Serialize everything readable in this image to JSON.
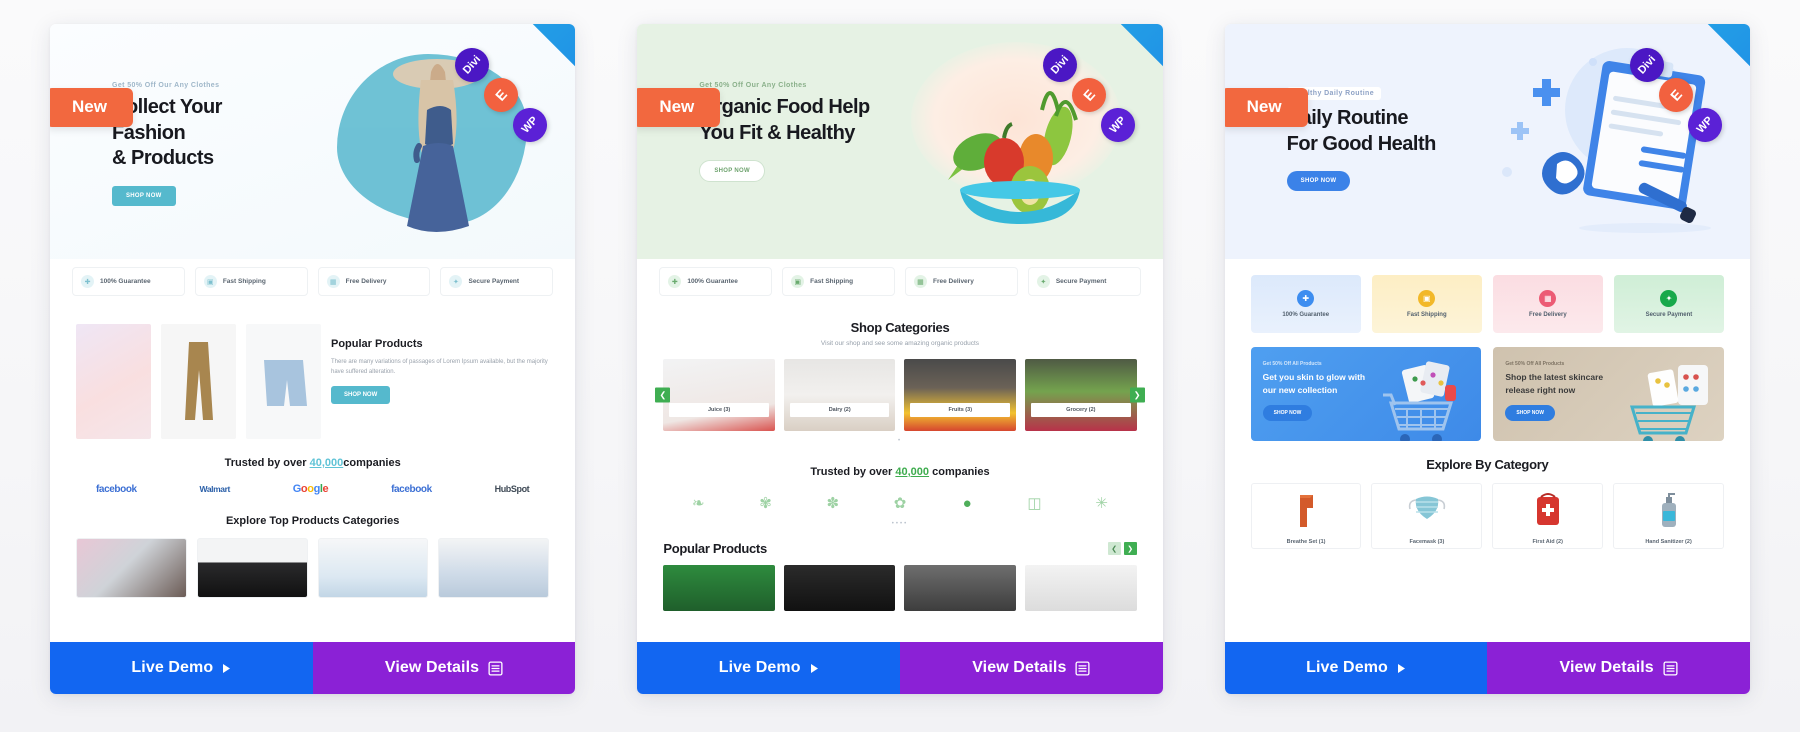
{
  "cards": [
    {
      "badge": "New",
      "ribbon": {
        "b1": "Divi",
        "b2": "E",
        "b3": "WP"
      },
      "hero": {
        "eyebrow": "Get 50% Off Our Any Clothes",
        "title": "Collect Your\nFashion\n& Products",
        "cta": "SHOP NOW"
      },
      "features": [
        {
          "label": "100% Guarantee",
          "icon": "shield-icon"
        },
        {
          "label": "Fast Shipping",
          "icon": "truck-icon"
        },
        {
          "label": "Free Delivery",
          "icon": "box-icon"
        },
        {
          "label": "Secure Payment",
          "icon": "lock-icon"
        }
      ],
      "popular": {
        "heading": "Popular Products",
        "body": "There are many variations of passages of Lorem Ipsum available, but the majority have suffered alteration.",
        "cta": "SHOP NOW"
      },
      "trusted": {
        "pre": "Trusted by over ",
        "num": "40,000",
        "post": "companies"
      },
      "logos": [
        "facebook",
        "Walmart",
        "Google",
        "facebook",
        "HubSpot"
      ],
      "explore": {
        "heading": "Explore Top Products Categories"
      },
      "actions": {
        "demo": "Live Demo",
        "details": "View Details"
      }
    },
    {
      "badge": "New",
      "ribbon": {
        "b1": "Divi",
        "b2": "E",
        "b3": "WP"
      },
      "hero": {
        "eyebrow": "Get 50% Off Our Any Clothes",
        "title": "Organic Food Help\nYou Fit & Healthy",
        "cta": "SHOP NOW"
      },
      "features": [
        {
          "label": "100% Guarantee",
          "icon": "shield-icon"
        },
        {
          "label": "Fast Shipping",
          "icon": "truck-icon"
        },
        {
          "label": "Free Delivery",
          "icon": "box-icon"
        },
        {
          "label": "Secure Payment",
          "icon": "lock-icon"
        }
      ],
      "shop": {
        "heading": "Shop Categories",
        "sub": "Visit our shop and see some amazing organic products",
        "items": [
          "Juice (3)",
          "Dairy (2)",
          "Fruits (3)",
          "Grocery (2)"
        ]
      },
      "trusted": {
        "pre": "Trusted by over ",
        "num": "40,000",
        "post": "companies"
      },
      "popular": {
        "heading": "Popular Products"
      },
      "actions": {
        "demo": "Live Demo",
        "details": "View Details"
      }
    },
    {
      "badge": "New",
      "ribbon": {
        "b1": "Divi",
        "b2": "E",
        "b3": "WP"
      },
      "hero": {
        "eyebrow": "Healthy Daily Routine",
        "title": "Daily Routine\nFor Good Health",
        "cta": "SHOP NOW"
      },
      "tiles": [
        {
          "label": "100% Guarantee",
          "icon": "shield-icon"
        },
        {
          "label": "Fast Shipping",
          "icon": "truck-icon"
        },
        {
          "label": "Free Delivery",
          "icon": "box-icon"
        },
        {
          "label": "Secure Payment",
          "icon": "lock-icon"
        }
      ],
      "promos": [
        {
          "eyebrow": "Get 50% Off All Products",
          "heading": "Get you skin to glow with\nour new collection",
          "cta": "SHOP NOW"
        },
        {
          "eyebrow": "Get 50% Off All Products",
          "heading": "Shop the latest skincare\nrelease right now",
          "cta": "SHOP NOW"
        }
      ],
      "explore": {
        "heading": "Explore By Category",
        "items": [
          "Breathe Set (1)",
          "Facemask (3)",
          "First Aid (2)",
          "Hand Sanitizer (2)"
        ]
      },
      "actions": {
        "demo": "Live Demo",
        "details": "View Details"
      }
    }
  ],
  "colors": {
    "demo_blue": "#1266f1",
    "details_purple": "#8b21d6",
    "badge_orange": "#f2683f",
    "ribbon_blue": "#1e88e5"
  }
}
